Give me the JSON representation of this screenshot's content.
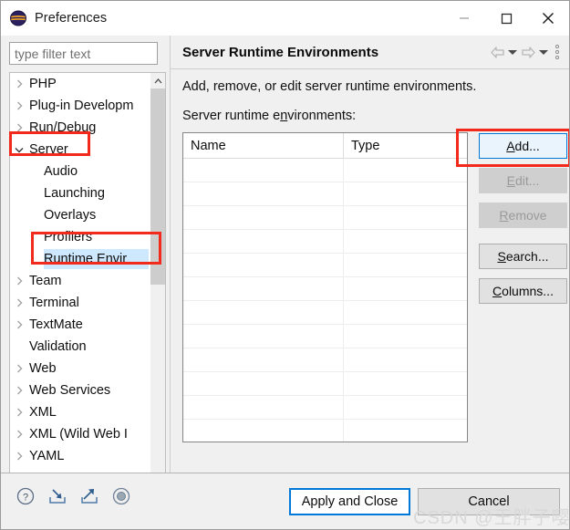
{
  "window": {
    "title": "Preferences",
    "icon": "eclipse-icon",
    "controls": {
      "minimize": "minimize-icon",
      "maximize": "maximize-icon",
      "close": "close-icon"
    }
  },
  "sidebar": {
    "filter": {
      "placeholder": "type filter text",
      "value": ""
    },
    "items": [
      {
        "label": "PHP",
        "expandable": true,
        "expanded": false,
        "child": false
      },
      {
        "label": "Plug-in Developm",
        "expandable": true,
        "expanded": false,
        "child": false
      },
      {
        "label": "Run/Debug",
        "expandable": true,
        "expanded": false,
        "child": false
      },
      {
        "label": "Server",
        "expandable": true,
        "expanded": true,
        "child": false
      },
      {
        "label": "Audio",
        "expandable": false,
        "expanded": false,
        "child": true
      },
      {
        "label": "Launching",
        "expandable": false,
        "expanded": false,
        "child": true
      },
      {
        "label": "Overlays",
        "expandable": false,
        "expanded": false,
        "child": true
      },
      {
        "label": "Profilers",
        "expandable": false,
        "expanded": false,
        "child": true
      },
      {
        "label": "Runtime Envir",
        "expandable": false,
        "expanded": false,
        "child": true,
        "selected": true
      },
      {
        "label": "Team",
        "expandable": true,
        "expanded": false,
        "child": false
      },
      {
        "label": "Terminal",
        "expandable": true,
        "expanded": false,
        "child": false
      },
      {
        "label": "TextMate",
        "expandable": true,
        "expanded": false,
        "child": false
      },
      {
        "label": "Validation",
        "expandable": false,
        "expanded": false,
        "child": false
      },
      {
        "label": "Web",
        "expandable": true,
        "expanded": false,
        "child": false
      },
      {
        "label": "Web Services",
        "expandable": true,
        "expanded": false,
        "child": false
      },
      {
        "label": "XML",
        "expandable": true,
        "expanded": false,
        "child": false
      },
      {
        "label": "XML (Wild Web I",
        "expandable": true,
        "expanded": false,
        "child": false
      },
      {
        "label": "YAML",
        "expandable": true,
        "expanded": false,
        "child": false
      }
    ],
    "scroll": {
      "up_arrow": "chevron-up-icon",
      "down_arrow": "chevron-down-icon",
      "left_arrow": "chevron-left-icon",
      "right_arrow": "chevron-right-icon"
    }
  },
  "page": {
    "title": "Server Runtime Environments",
    "description": "Add, remove, or edit server runtime environments.",
    "list_label_pre": "Server runtime e",
    "list_label_mnemonic": "n",
    "list_label_post": "vironments:",
    "nav": {
      "back": "arrow-left-icon",
      "back_menu": "chevron-down-icon",
      "forward": "arrow-right-icon",
      "forward_menu": "chevron-down-icon",
      "menu": "kebab-menu-icon"
    },
    "table": {
      "columns": [
        "Name",
        "Type"
      ],
      "rows": []
    },
    "buttons": [
      {
        "label_pre": "",
        "mnemonic": "A",
        "label_post": "dd...",
        "state": "primary",
        "name": "add-button"
      },
      {
        "label_pre": "",
        "mnemonic": "E",
        "label_post": "dit...",
        "state": "disabled",
        "name": "edit-button"
      },
      {
        "label_pre": "",
        "mnemonic": "R",
        "label_post": "emove",
        "state": "disabled",
        "name": "remove-button"
      },
      {
        "label_pre": "",
        "mnemonic": "S",
        "label_post": "earch...",
        "state": "normal",
        "name": "search-button"
      },
      {
        "label_pre": "",
        "mnemonic": "C",
        "label_post": "olumns...",
        "state": "normal",
        "name": "columns-button"
      }
    ]
  },
  "footer": {
    "icons": [
      {
        "name": "help-icon",
        "glyph": "?"
      },
      {
        "name": "import-icon",
        "glyph": "import"
      },
      {
        "name": "export-icon",
        "glyph": "export"
      },
      {
        "name": "record-icon",
        "glyph": "record"
      }
    ],
    "apply_and_close": "Apply and Close",
    "cancel": "Cancel"
  },
  "watermark": "CSDN @王胖子嘤",
  "colors": {
    "accent": "#0078d7",
    "annotation": "#f22a1c",
    "selection": "#cde8ff",
    "dialog_bg": "#f0f0f0"
  }
}
